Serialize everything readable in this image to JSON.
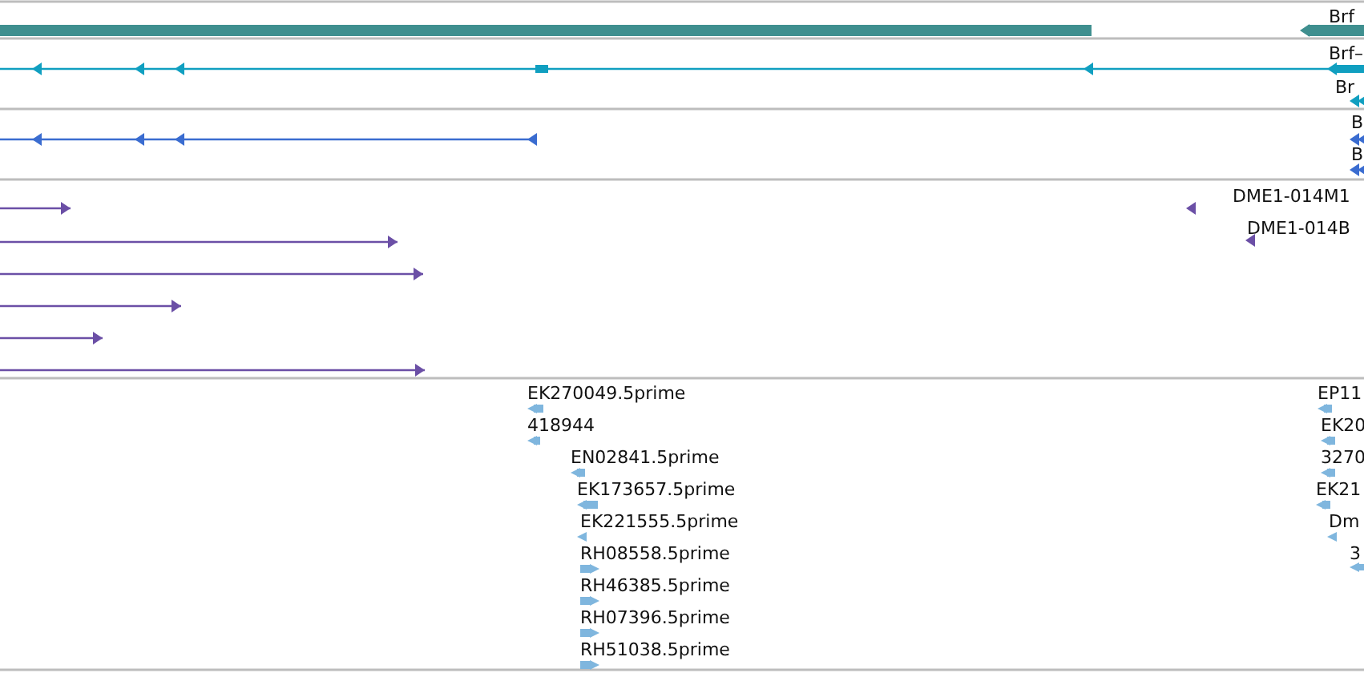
{
  "tracks": [
    {
      "kind": "gene",
      "features": [
        {
          "kind": "block"
        },
        {
          "kind": "arrow",
          "label": "Brf",
          "reverse": true
        }
      ]
    },
    {
      "kind": "transcript",
      "features": [
        {
          "reverse": true
        },
        {
          "label": "Brf–",
          "reverse": true
        },
        {
          "label": "Br",
          "reverse": true
        }
      ]
    },
    {
      "kind": "protein",
      "features": [
        {
          "reverse": true
        },
        {
          "label": "B",
          "reverse": true
        },
        {
          "label": "B",
          "reverse": true
        }
      ]
    },
    {
      "kind": "probe",
      "features": [
        {
          "reverse": false
        },
        {
          "reverse": false
        },
        {
          "reverse": false
        },
        {
          "reverse": false
        },
        {
          "reverse": false
        },
        {
          "reverse": false
        },
        {
          "label": "DME1-014M1",
          "reverse": true
        },
        {
          "label": "DME1-014B",
          "reverse": true
        }
      ]
    },
    {
      "kind": "est",
      "features": [
        {
          "label": "EK270049.5prime",
          "reverse": true
        },
        {
          "label": "418944",
          "reverse": true
        },
        {
          "label": "EN02841.5prime",
          "reverse": true
        },
        {
          "label": "EK173657.5prime",
          "reverse": true
        },
        {
          "label": "EK221555.5prime",
          "reverse": true
        },
        {
          "label": "RH08558.5prime",
          "reverse": false
        },
        {
          "label": "RH46385.5prime",
          "reverse": false
        },
        {
          "label": "RH07396.5prime",
          "reverse": false
        },
        {
          "label": "RH51038.5prime",
          "reverse": false
        },
        {
          "label": "EP11",
          "reverse": true
        },
        {
          "label": "EK20",
          "reverse": true
        },
        {
          "label": "3270",
          "reverse": true
        },
        {
          "label": "EK21",
          "reverse": true
        },
        {
          "label": "Dm",
          "reverse": true
        },
        {
          "label": "3",
          "reverse": true
        }
      ]
    }
  ]
}
